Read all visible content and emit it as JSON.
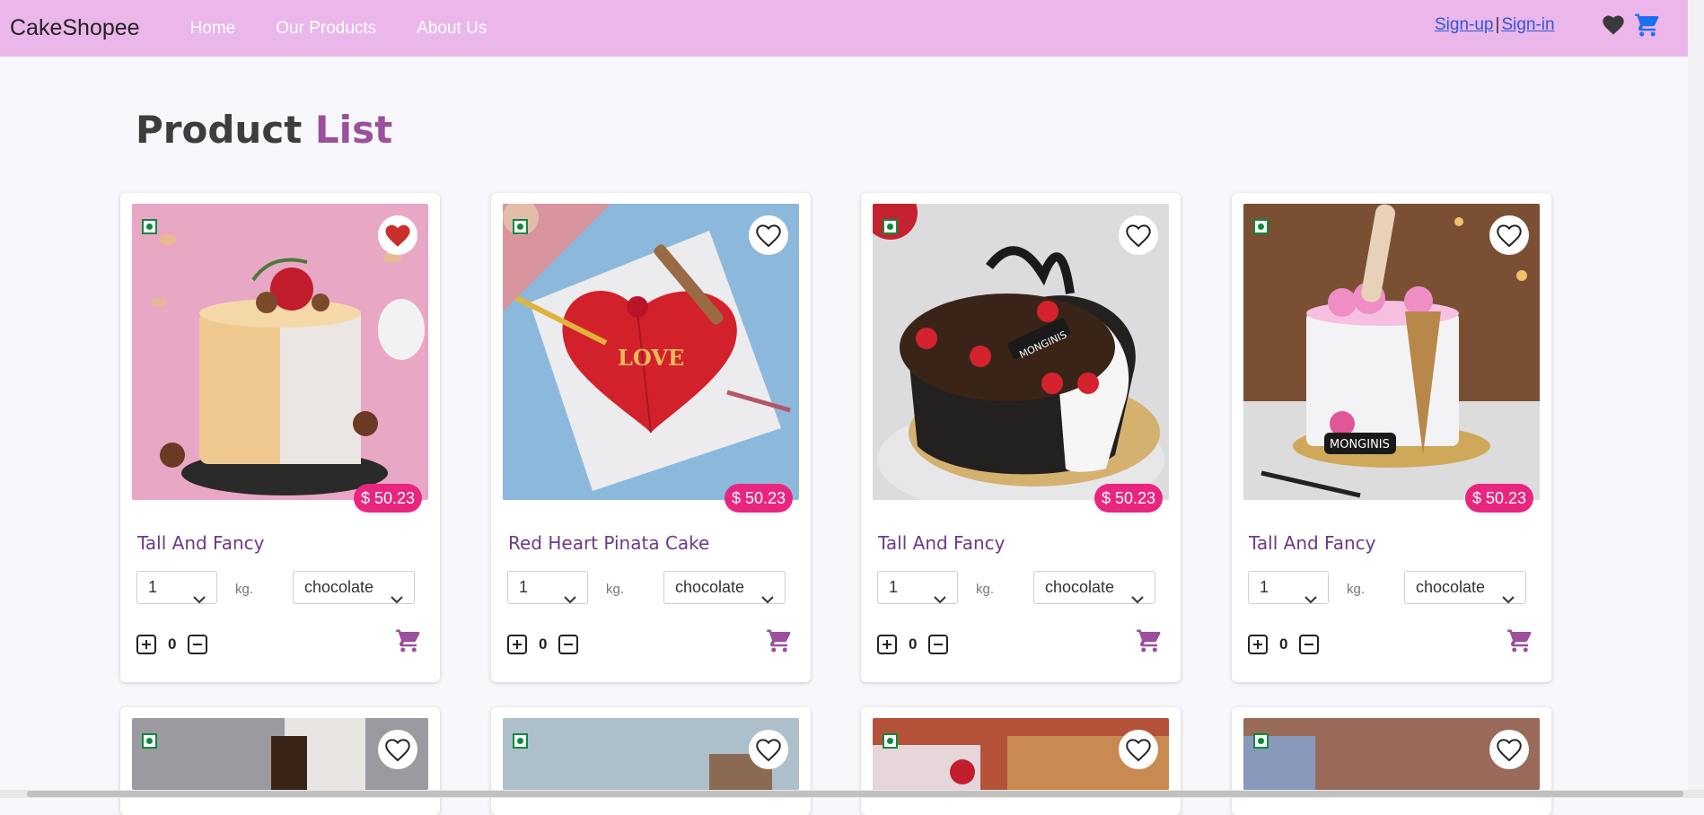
{
  "brand": "CakeShopee",
  "nav": [
    "Home",
    "Our Products",
    "About Us"
  ],
  "auth": {
    "signup": "Sign-up",
    "separator": "|",
    "signin": "Sign-in"
  },
  "title": {
    "part1": "Product ",
    "part2": "List"
  },
  "colors": {
    "navbar": "#ebb6ea",
    "accent": "#9b4f9c",
    "price_badge": "#e8267f",
    "product_name": "#6b3a8b"
  },
  "products": [
    {
      "name": "Tall And Fancy",
      "price": "$ 50.23",
      "qty": "1",
      "unit": "kg.",
      "flavor": "chocolate",
      "count": "0",
      "favorite": true
    },
    {
      "name": "Red Heart Pinata Cake",
      "price": "$ 50.23",
      "qty": "1",
      "unit": "kg.",
      "flavor": "chocolate",
      "count": "0",
      "favorite": false
    },
    {
      "name": "Tall And Fancy",
      "price": "$ 50.23",
      "qty": "1",
      "unit": "kg.",
      "flavor": "chocolate",
      "count": "0",
      "favorite": false
    },
    {
      "name": "Tall And Fancy",
      "price": "$ 50.23",
      "qty": "1",
      "unit": "kg.",
      "flavor": "chocolate",
      "count": "0",
      "favorite": false
    }
  ],
  "icons": [
    "heart-icon",
    "cart-icon",
    "veg-mark-icon",
    "plus-square-icon",
    "minus-square-icon",
    "chevron-down-icon"
  ]
}
